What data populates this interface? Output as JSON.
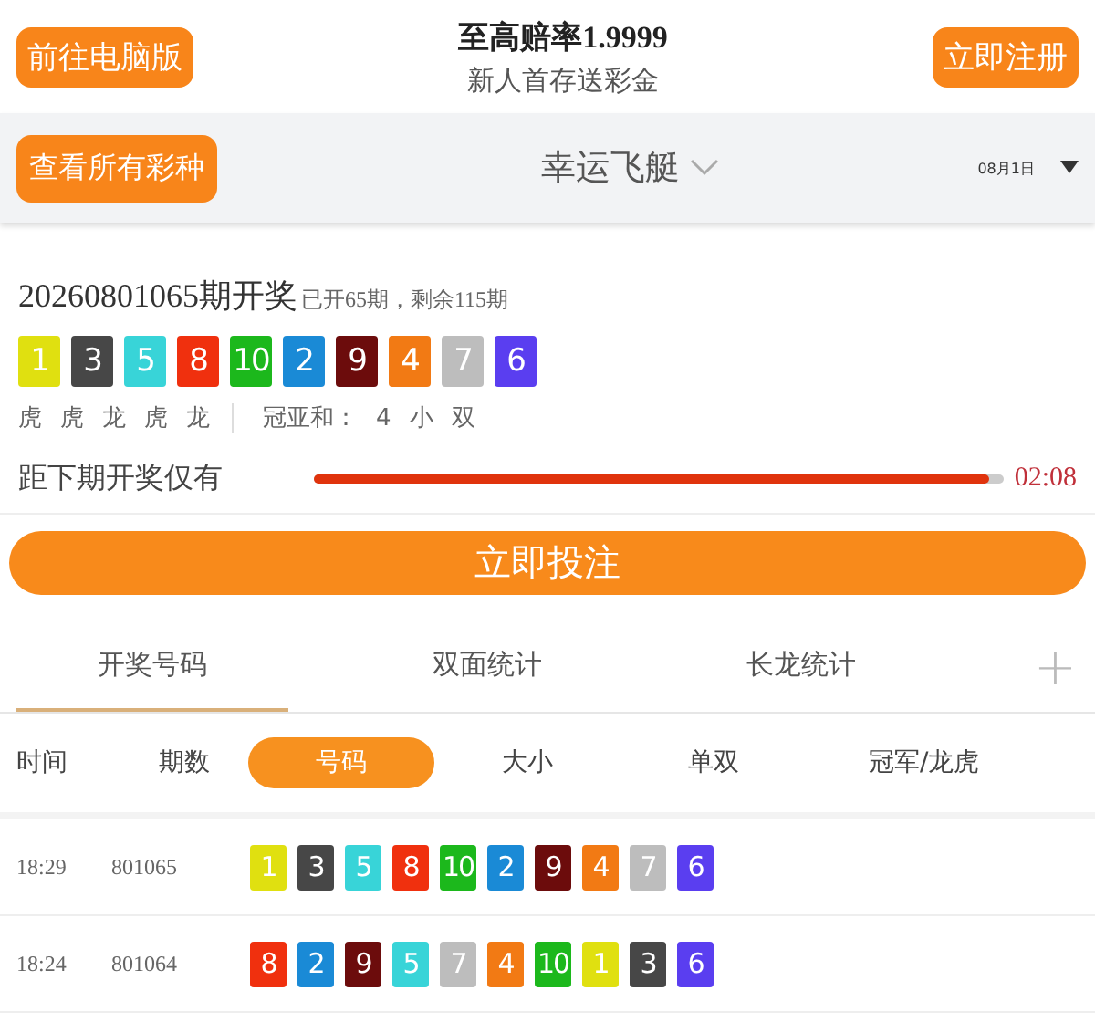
{
  "header": {
    "left_button": "前往电脑版",
    "title": "至高赔率1.9999",
    "subtitle": "新人首存送彩金",
    "right_button": "立即注册"
  },
  "lottery_bar": {
    "all_button": "查看所有彩种",
    "name": "幸运飞艇",
    "date": "08月1日"
  },
  "draw": {
    "issue": "20260801065期开奖",
    "progress_text": "已开65期，剩余115期",
    "balls": [
      {
        "n": "1",
        "color": "#e0e010"
      },
      {
        "n": "3",
        "color": "#474747"
      },
      {
        "n": "5",
        "color": "#38d4d8"
      },
      {
        "n": "8",
        "color": "#f0300e"
      },
      {
        "n": "10",
        "color": "#1cb81c"
      },
      {
        "n": "2",
        "color": "#1a8ad6"
      },
      {
        "n": "9",
        "color": "#6c0c0c"
      },
      {
        "n": "4",
        "color": "#f27a14"
      },
      {
        "n": "7",
        "color": "#bdbdbd"
      },
      {
        "n": "6",
        "color": "#5a3ef0"
      }
    ],
    "dragon_tiger": [
      "虎",
      "虎",
      "龙",
      "虎",
      "龙"
    ],
    "sum_label": "冠亚和：",
    "sum_values": [
      "4",
      "小",
      "双"
    ],
    "countdown_label": "距下期开奖仅有",
    "level": 0.98,
    "countdown": "02:08"
  },
  "bet_button": "立即投注",
  "tabs": [
    {
      "label": "开奖号码",
      "selected": true
    },
    {
      "label": "双面统计",
      "selected": false
    },
    {
      "label": "长龙统计",
      "selected": false
    }
  ],
  "add_icon": "+",
  "columns": [
    {
      "label": "时间",
      "kind": "header"
    },
    {
      "label": "期数",
      "kind": "header"
    },
    {
      "label": "号码",
      "kind": "filter",
      "selected": true
    },
    {
      "label": "大小",
      "kind": "filter",
      "selected": false
    },
    {
      "label": "单双",
      "kind": "filter",
      "selected": false
    },
    {
      "label": "冠军/龙虎",
      "kind": "filter",
      "selected": false
    }
  ],
  "rows": [
    {
      "time": "18:29",
      "issue": "801065",
      "balls": [
        {
          "n": "1",
          "color": "#e0e010"
        },
        {
          "n": "3",
          "color": "#474747"
        },
        {
          "n": "5",
          "color": "#38d4d8"
        },
        {
          "n": "8",
          "color": "#f0300e"
        },
        {
          "n": "10",
          "color": "#1cb81c"
        },
        {
          "n": "2",
          "color": "#1a8ad6"
        },
        {
          "n": "9",
          "color": "#6c0c0c"
        },
        {
          "n": "4",
          "color": "#f27a14"
        },
        {
          "n": "7",
          "color": "#bdbdbd"
        },
        {
          "n": "6",
          "color": "#5a3ef0"
        }
      ]
    },
    {
      "time": "18:24",
      "issue": "801064",
      "balls": [
        {
          "n": "8",
          "color": "#f0300e"
        },
        {
          "n": "2",
          "color": "#1a8ad6"
        },
        {
          "n": "9",
          "color": "#6c0c0c"
        },
        {
          "n": "5",
          "color": "#38d4d8"
        },
        {
          "n": "7",
          "color": "#bdbdbd"
        },
        {
          "n": "4",
          "color": "#f27a14"
        },
        {
          "n": "10",
          "color": "#1cb81c"
        },
        {
          "n": "1",
          "color": "#e0e010"
        },
        {
          "n": "3",
          "color": "#474747"
        },
        {
          "n": "6",
          "color": "#5a3ef0"
        }
      ]
    }
  ]
}
